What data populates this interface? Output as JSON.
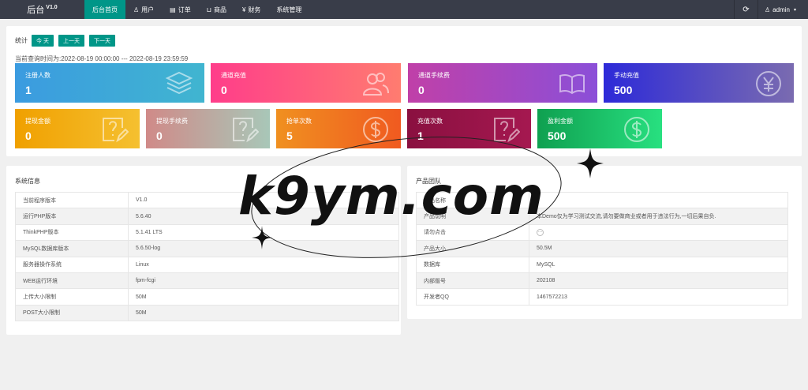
{
  "header": {
    "logo": "后台",
    "version": "V1.0",
    "nav": [
      {
        "label": "后台首页",
        "icon": ""
      },
      {
        "label": "用户",
        "icon": "♙"
      },
      {
        "label": "订单",
        "icon": "▤"
      },
      {
        "label": "商品",
        "icon": "⊔"
      },
      {
        "label": "财务",
        "icon": "¥"
      },
      {
        "label": "系统管理",
        "icon": ""
      }
    ],
    "refresh_icon": "⟳",
    "user_icon": "♙",
    "user": "admin",
    "caret": "▾"
  },
  "stats": {
    "filter_label": "统计",
    "buttons": [
      "今 天",
      "上一天",
      "下一天"
    ],
    "range_text": "当前查询时间为:2022-08-19 00:00:00 --- 2022-08-19 23:59:59",
    "tiles": [
      {
        "label": "注册人数",
        "value": "1",
        "icon": "layers-icon"
      },
      {
        "label": "通道充值",
        "value": "0",
        "icon": "users-icon"
      },
      {
        "label": "通道手续费",
        "value": "0",
        "icon": "book-icon"
      },
      {
        "label": "手动充值",
        "value": "500",
        "icon": "yen-icon"
      },
      {
        "label": "提现金额",
        "value": "0",
        "icon": "question-edit-icon"
      },
      {
        "label": "提现手续费",
        "value": "0",
        "icon": "question-edit-icon"
      },
      {
        "label": "抢单次数",
        "value": "5",
        "icon": "dollar-icon"
      },
      {
        "label": "充值次数",
        "value": "1",
        "icon": "question-edit-icon"
      },
      {
        "label": "盈利金额",
        "value": "500",
        "icon": "dollar-icon"
      }
    ]
  },
  "system": {
    "title": "系统信息",
    "rows": [
      {
        "k": "当前程序版本",
        "v": "V1.0"
      },
      {
        "k": "运行PHP版本",
        "v": "5.6.40"
      },
      {
        "k": "ThinkPHP版本",
        "v": "5.1.41 LTS"
      },
      {
        "k": "MySQL数据库版本",
        "v": "5.6.50-log"
      },
      {
        "k": "服务器操作系统",
        "v": "Linux"
      },
      {
        "k": "WEB运行环境",
        "v": "fpm-fcgi"
      },
      {
        "k": "上传大小限制",
        "v": "50M"
      },
      {
        "k": "POST大小限制",
        "v": "50M"
      }
    ]
  },
  "team": {
    "title": "产品团队",
    "rows": [
      {
        "k": "产品名称",
        "v": ""
      },
      {
        "k": "产品说明",
        "v": "本Demo仅为学习测试交流,请勿要做商业或者用于违法行为,一切后果自负."
      },
      {
        "k": "请勿点击",
        "v": "···"
      },
      {
        "k": "产品大小",
        "v": "50.5M"
      },
      {
        "k": "数据库",
        "v": "MySQL"
      },
      {
        "k": "内部版号",
        "v": "202108"
      },
      {
        "k": "开发者QQ",
        "v": "1467572213"
      }
    ]
  },
  "watermark": {
    "text": "k9ym.com"
  }
}
